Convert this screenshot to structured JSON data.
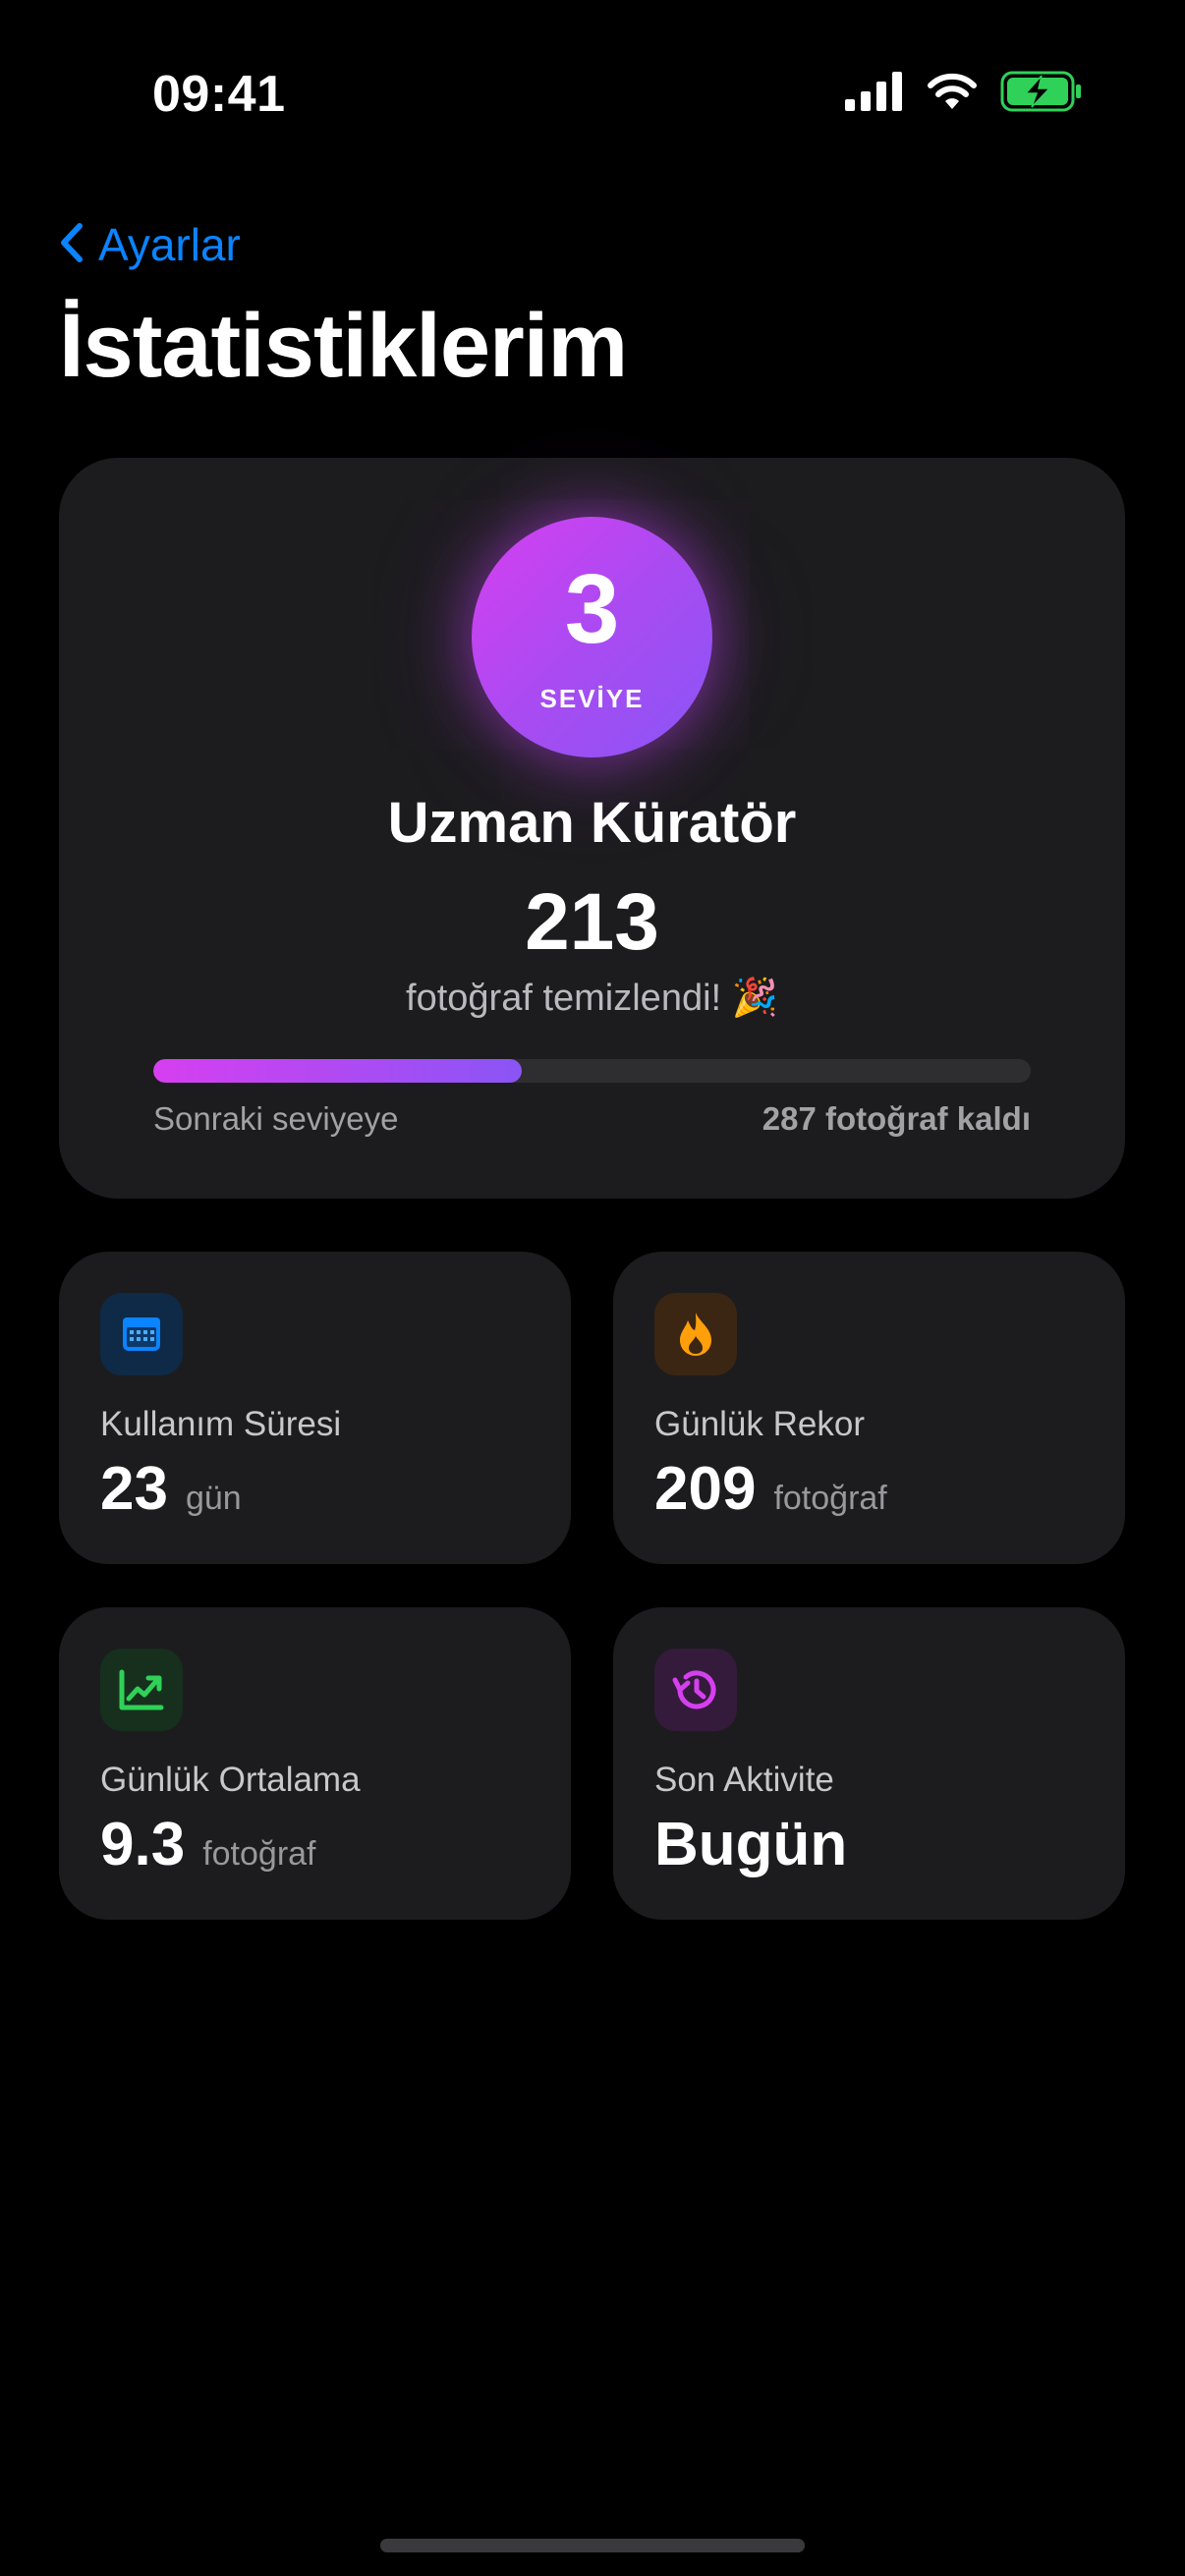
{
  "status_bar": {
    "time": "09:41",
    "icons": [
      "cellular-signal-icon",
      "wifi-icon",
      "battery-charging-icon"
    ],
    "battery_color": "#30d158"
  },
  "nav": {
    "back_label": "Ayarlar",
    "back_icon": "chevron-left-icon",
    "title": "İstatistiklerim",
    "accent_color": "#0a84ff"
  },
  "level_card": {
    "level_number": "3",
    "level_caption": "SEVİYE",
    "rank_title": "Uzman Küratör",
    "cleaned_count": "213",
    "cleaned_text": "fotoğraf temizlendi! 🎉",
    "progress_fraction": 0.42,
    "progress_left_label": "Sonraki seviyeye",
    "progress_right_label": "287 fotoğraf kaldı",
    "gradient_colors": [
      "#d63ff0",
      "#8a55f5"
    ]
  },
  "stats": [
    {
      "icon": "calendar-icon",
      "icon_color": "#0a84ff",
      "icon_bg": "#0f2a47",
      "label": "Kullanım Süresi",
      "value": "23",
      "unit": "gün"
    },
    {
      "icon": "flame-icon",
      "icon_color": "#ff9f0a",
      "icon_bg": "#3b2614",
      "label": "Günlük Rekor",
      "value": "209",
      "unit": "fotoğraf"
    },
    {
      "icon": "trend-up-chart-icon",
      "icon_color": "#30d158",
      "icon_bg": "#16301d",
      "label": "Günlük Ortalama",
      "value": "9.3",
      "unit": "fotoğraf"
    },
    {
      "icon": "history-clock-icon",
      "icon_color": "#d63ff0",
      "icon_bg": "#341b3b",
      "label": "Son Aktivite",
      "value": "Bugün",
      "unit": ""
    }
  ]
}
